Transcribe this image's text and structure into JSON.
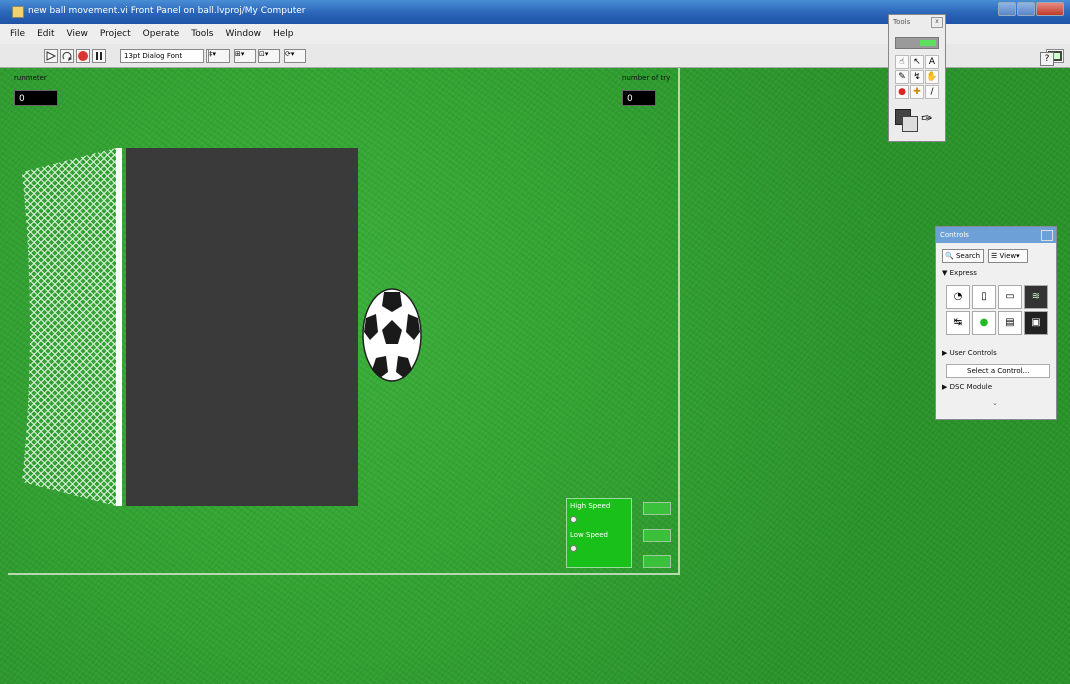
{
  "window": {
    "title": "new ball movement.vi Front Panel on ball.lvproj/My Computer"
  },
  "menu": [
    "File",
    "Edit",
    "View",
    "Project",
    "Operate",
    "Tools",
    "Window",
    "Help"
  ],
  "toolbar": {
    "font_select": "13pt Dialog Font"
  },
  "indicators": {
    "left_label": "runmeter",
    "left_value": "0",
    "right_label": "number of try",
    "right_value": "0"
  },
  "speed": {
    "high_label": "High Speed",
    "low_label": "Low Speed"
  },
  "tools_palette": {
    "title": "Tools"
  },
  "controls_palette": {
    "title": "Controls",
    "search_label": "Search",
    "view_label": "View",
    "express_label": "Express",
    "user_controls_label": "User Controls",
    "select_control_label": "Select a Control...",
    "dsc_module_label": "DSC Module"
  },
  "help_label": "?"
}
